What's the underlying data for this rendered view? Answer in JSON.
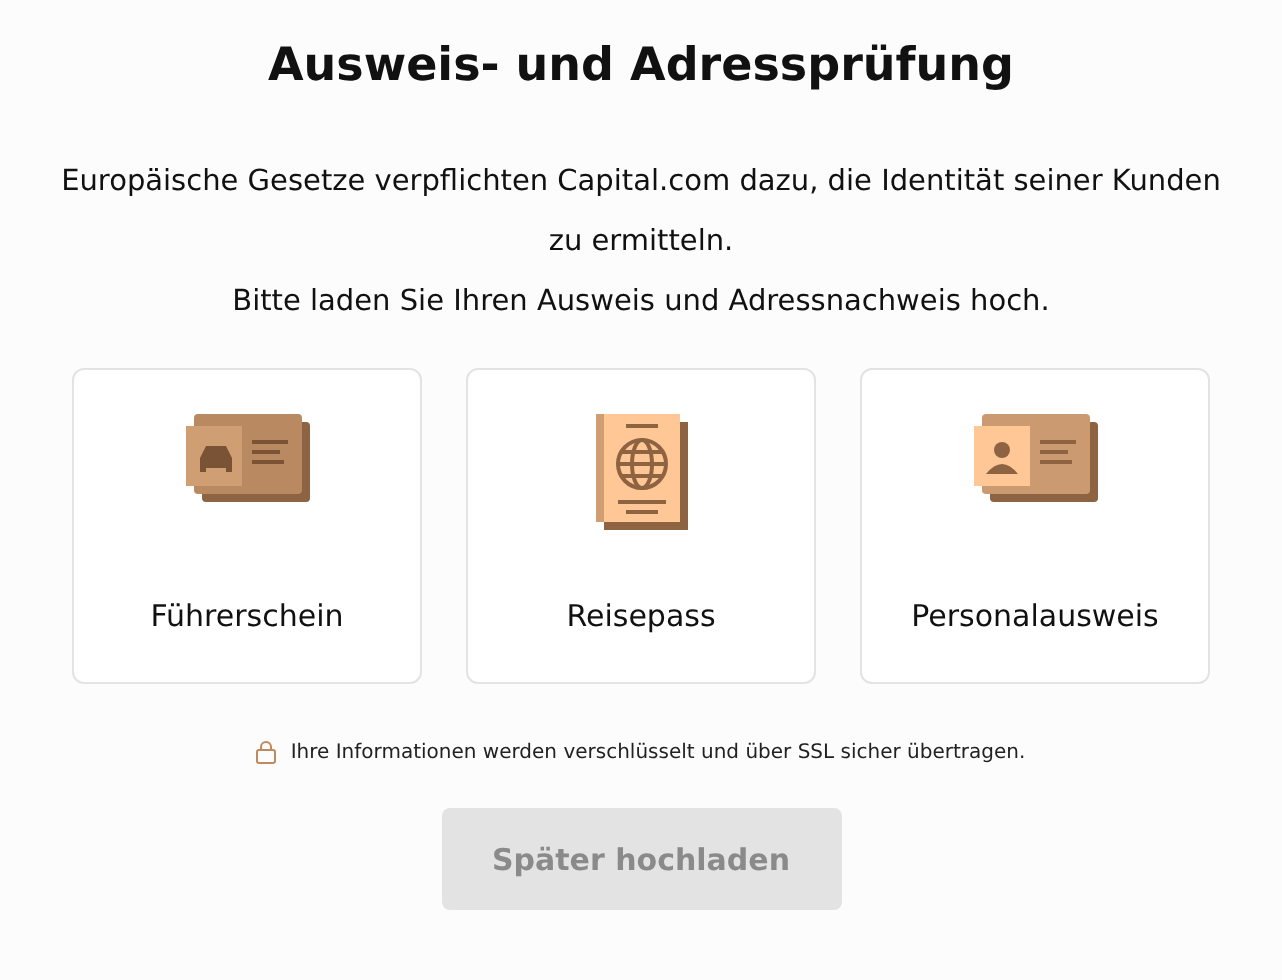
{
  "title": "Ausweis- und Adressprüfung",
  "intro": [
    "Europäische Gesetze verpflichten Capital.com dazu, die Identität seiner Kunden zu ermitteln.",
    "Bitte laden Sie Ihren Ausweis und Adressnachweis hoch."
  ],
  "documents": [
    {
      "kind": "license",
      "label": "Führerschein"
    },
    {
      "kind": "passport",
      "label": "Reisepass"
    },
    {
      "kind": "id",
      "label": "Personalausweis"
    }
  ],
  "security_note": "Ihre Informationen werden verschlüsselt und über SSL sicher übertragen.",
  "button": {
    "label": "Später hochladen",
    "disabled": true
  }
}
